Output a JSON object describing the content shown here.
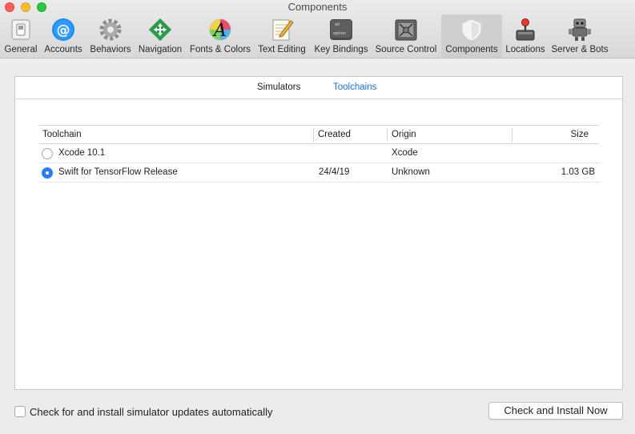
{
  "window": {
    "title": "Components"
  },
  "toolbar": {
    "items": [
      {
        "label": "General",
        "icon": "general-switch-icon"
      },
      {
        "label": "Accounts",
        "icon": "at-sign-icon"
      },
      {
        "label": "Behaviors",
        "icon": "gear-icon"
      },
      {
        "label": "Navigation",
        "icon": "navigation-arrows-icon"
      },
      {
        "label": "Fonts & Colors",
        "icon": "font-a-icon"
      },
      {
        "label": "Text Editing",
        "icon": "notepad-pencil-icon"
      },
      {
        "label": "Key Bindings",
        "icon": "option-key-icon"
      },
      {
        "label": "Source Control",
        "icon": "safe-icon"
      },
      {
        "label": "Components",
        "icon": "shield-icon"
      },
      {
        "label": "Locations",
        "icon": "joystick-icon"
      },
      {
        "label": "Server & Bots",
        "icon": "robot-icon"
      }
    ],
    "selected": "Components"
  },
  "tabs": [
    {
      "label": "Simulators"
    },
    {
      "label": "Toolchains"
    }
  ],
  "selected_tab": "Toolchains",
  "table": {
    "columns": [
      "Toolchain",
      "Created",
      "Origin",
      "Size"
    ],
    "rows": [
      {
        "toolchain": "Xcode 10.1",
        "created": "",
        "origin": "Xcode",
        "size": "",
        "selected": false
      },
      {
        "toolchain": "Swift for TensorFlow Release",
        "created": "24/4/19",
        "origin": "Unknown",
        "size": "1.03 GB",
        "selected": true
      }
    ]
  },
  "footer": {
    "auto_update_label": "Check for and install simulator updates automatically",
    "auto_update_checked": false,
    "install_button": "Check and Install Now"
  },
  "colors": {
    "accent": "#2c7df0",
    "selected_tab": "#1a6fd6"
  }
}
